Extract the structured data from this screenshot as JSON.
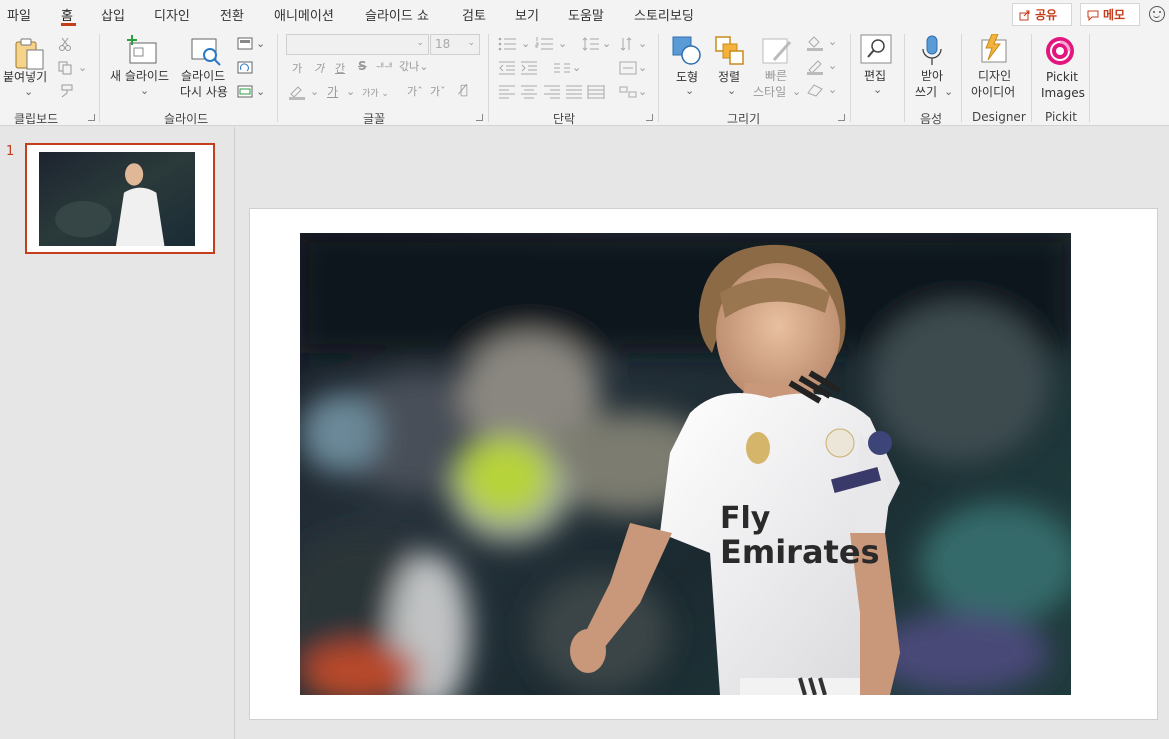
{
  "menu": {
    "tabs": [
      "파일",
      "홈",
      "삽입",
      "디자인",
      "전환",
      "애니메이션",
      "슬라이드 쇼",
      "검토",
      "보기",
      "도움말",
      "스토리보딩"
    ],
    "share_label": "공유",
    "memo_label": "메모"
  },
  "ribbon": {
    "clipboard": {
      "paste_label": "붙여넣기",
      "group_label": "클립보드"
    },
    "slides": {
      "new_slide_label": "새 슬라이드",
      "reuse_line1": "슬라이드",
      "reuse_line2": "다시 사용",
      "group_label": "슬라이드"
    },
    "font": {
      "font_size": "18",
      "group_label": "글꼴"
    },
    "paragraph": {
      "group_label": "단락"
    },
    "drawing": {
      "shape_label": "도형",
      "arrange_label": "정렬",
      "quick_style_line1": "빠른",
      "quick_style_line2": "스타일",
      "group_label": "그리기"
    },
    "editing": {
      "edit_label": "편집"
    },
    "voice": {
      "dictate_line1": "받아",
      "dictate_line2": "쓰기",
      "group_label": "음성"
    },
    "designer": {
      "design_line1": "디자인",
      "design_line2": "아이디어",
      "group_label": "Designer"
    },
    "pickit": {
      "line1": "Pickit",
      "line2": "Images",
      "group_label": "Pickit"
    }
  },
  "slides_panel": {
    "slides": [
      {
        "number": "1"
      }
    ]
  },
  "colors": {
    "accent": "#c43e1c",
    "pickit": "#e3157e"
  }
}
